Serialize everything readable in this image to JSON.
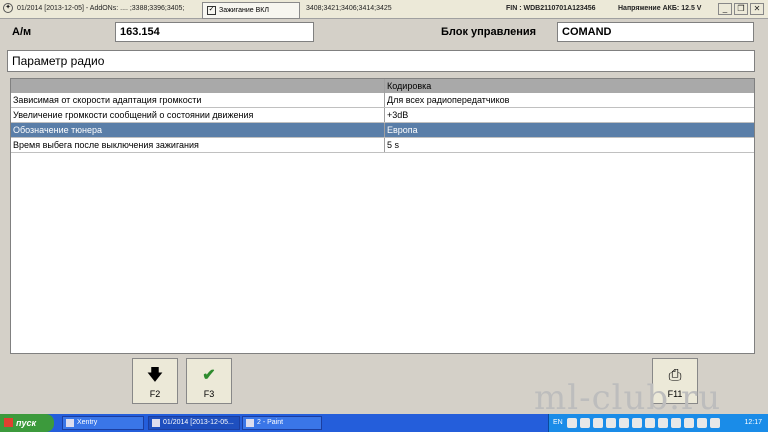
{
  "topbar": {
    "version": "01/2014 [2013-12-05] - AddONs: .... ;3388;3396;3405;",
    "addons_tail": "3408;3421;3406;3414;3425",
    "ignition_popup": "Зажигание ВКЛ",
    "fin": "FIN : WDB2110701A123456",
    "battery": "Напряжение АКБ: 12.5 V"
  },
  "header": {
    "am_label": "А/м",
    "am_value": "163.154",
    "control_unit_label": "Блок управления",
    "control_unit_value": "COMAND"
  },
  "panel_title": "Параметр радио",
  "table": {
    "columns": [
      "",
      "Кодировка"
    ],
    "rows": [
      {
        "param": "Зависимая от скорости адаптация громкости",
        "value": "Для всех радиопередатчиков",
        "selected": false
      },
      {
        "param": "Увеличение громкости сообщений о состоянии движения",
        "value": "+3dB",
        "selected": false
      },
      {
        "param": "Обозначение тюнера",
        "value": "Европа",
        "selected": true
      },
      {
        "param": "Время выбега после выключения зажигания",
        "value": "5 s",
        "selected": false
      }
    ]
  },
  "fkeys": {
    "f2": {
      "label": "F2",
      "icon": "arrow-down-icon"
    },
    "f3": {
      "label": "F3",
      "icon": "checkmark-icon"
    },
    "f11": {
      "label": "F11",
      "icon": "printer-icon"
    }
  },
  "watermark": "ml-club.ru",
  "taskbar": {
    "start": "пуск",
    "tasks": [
      "Xentry",
      "01/2014 [2013-12-05...",
      "2 - Paint"
    ],
    "lang": "EN",
    "clock": "12:17"
  },
  "colors": {
    "selected_row": "#5a7ea8",
    "header_row": "#a9a9a9",
    "taskbar": "#245edb",
    "check_green": "#2e8b2e"
  }
}
